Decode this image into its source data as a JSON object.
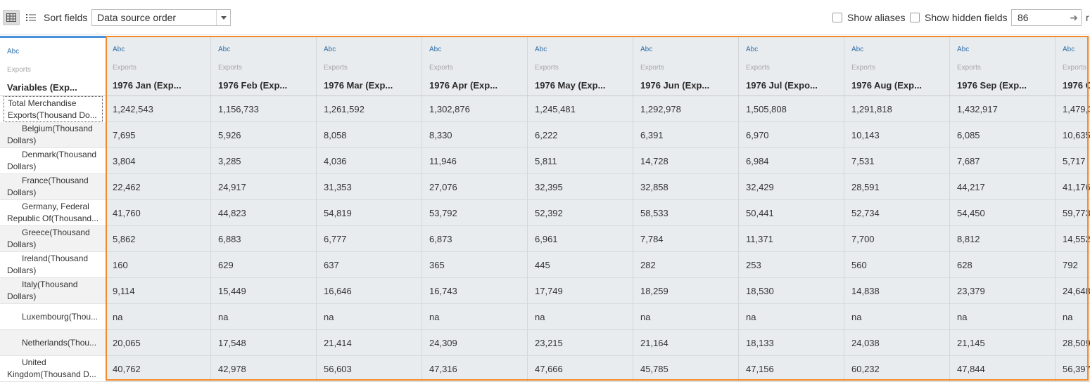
{
  "toolbar": {
    "sort_label": "Sort fields",
    "sort_value": "Data source order",
    "show_aliases": "Show aliases",
    "show_hidden": "Show hidden fields",
    "rows_value": "86",
    "rows_suffix": "r"
  },
  "row_header": {
    "type": "Abc",
    "source": "Exports",
    "title": "Variables (Exp..."
  },
  "columns": [
    {
      "type": "Abc",
      "source": "Exports",
      "title": "1976 Jan (Exp...",
      "values": [
        "1,242,543",
        "7,695",
        "3,804",
        "22,462",
        "41,760",
        "5,862",
        "160",
        "9,114",
        "na",
        "20,065",
        "40,762"
      ]
    },
    {
      "type": "Abc",
      "source": "Exports",
      "title": "1976 Feb (Exp...",
      "values": [
        "1,156,733",
        "5,926",
        "3,285",
        "24,917",
        "44,823",
        "6,883",
        "629",
        "15,449",
        "na",
        "17,548",
        "42,978"
      ]
    },
    {
      "type": "Abc",
      "source": "Exports",
      "title": "1976 Mar (Exp...",
      "values": [
        "1,261,592",
        "8,058",
        "4,036",
        "31,353",
        "54,819",
        "6,777",
        "637",
        "16,646",
        "na",
        "21,414",
        "56,603"
      ]
    },
    {
      "type": "Abc",
      "source": "Exports",
      "title": "1976 Apr (Exp...",
      "values": [
        "1,302,876",
        "8,330",
        "11,946",
        "27,076",
        "53,792",
        "6,873",
        "365",
        "16,743",
        "na",
        "24,309",
        "47,316"
      ]
    },
    {
      "type": "Abc",
      "source": "Exports",
      "title": "1976 May (Exp...",
      "values": [
        "1,245,481",
        "6,222",
        "5,811",
        "32,395",
        "52,392",
        "6,961",
        "445",
        "17,749",
        "na",
        "23,215",
        "47,666"
      ]
    },
    {
      "type": "Abc",
      "source": "Exports",
      "title": "1976 Jun (Exp...",
      "values": [
        "1,292,978",
        "6,391",
        "14,728",
        "32,858",
        "58,533",
        "7,784",
        "282",
        "18,259",
        "na",
        "21,164",
        "45,785"
      ]
    },
    {
      "type": "Abc",
      "source": "Exports",
      "title": "1976 Jul (Expo...",
      "values": [
        "1,505,808",
        "6,970",
        "6,984",
        "32,429",
        "50,441",
        "11,371",
        "253",
        "18,530",
        "na",
        "18,133",
        "47,156"
      ]
    },
    {
      "type": "Abc",
      "source": "Exports",
      "title": "1976 Aug (Exp...",
      "values": [
        "1,291,818",
        "10,143",
        "7,531",
        "28,591",
        "52,734",
        "7,700",
        "560",
        "14,838",
        "na",
        "24,038",
        "60,232"
      ]
    },
    {
      "type": "Abc",
      "source": "Exports",
      "title": "1976 Sep (Exp...",
      "values": [
        "1,432,917",
        "6,085",
        "7,687",
        "44,217",
        "54,450",
        "8,812",
        "628",
        "23,379",
        "na",
        "21,145",
        "47,844"
      ]
    },
    {
      "type": "Abc",
      "source": "Exports",
      "title": "1976 O",
      "values": [
        "1,479,3",
        "10,635",
        "5,717",
        "41,176",
        "59,773",
        "14,552",
        "792",
        "24,648",
        "na",
        "28,509",
        "56,397"
      ]
    }
  ],
  "rows": [
    {
      "line1": "Total Merchandise",
      "line2": "Exports(Thousand Do..."
    },
    {
      "line1": "Belgium(Thousand",
      "line2": "Dollars)"
    },
    {
      "line1": "Denmark(Thousand",
      "line2": "Dollars)"
    },
    {
      "line1": "France(Thousand",
      "line2": "Dollars)"
    },
    {
      "line1": "Germany, Federal",
      "line2": "Republic Of(Thousand..."
    },
    {
      "line1": "Greece(Thousand",
      "line2": "Dollars)"
    },
    {
      "line1": "Ireland(Thousand",
      "line2": "Dollars)"
    },
    {
      "line1": "Italy(Thousand",
      "line2": "Dollars)"
    },
    {
      "line1": "Luxembourg(Thou...",
      "line2": ""
    },
    {
      "line1": "Netherlands(Thou...",
      "line2": ""
    },
    {
      "line1": "United",
      "line2": "Kingdom(Thousand D..."
    }
  ]
}
